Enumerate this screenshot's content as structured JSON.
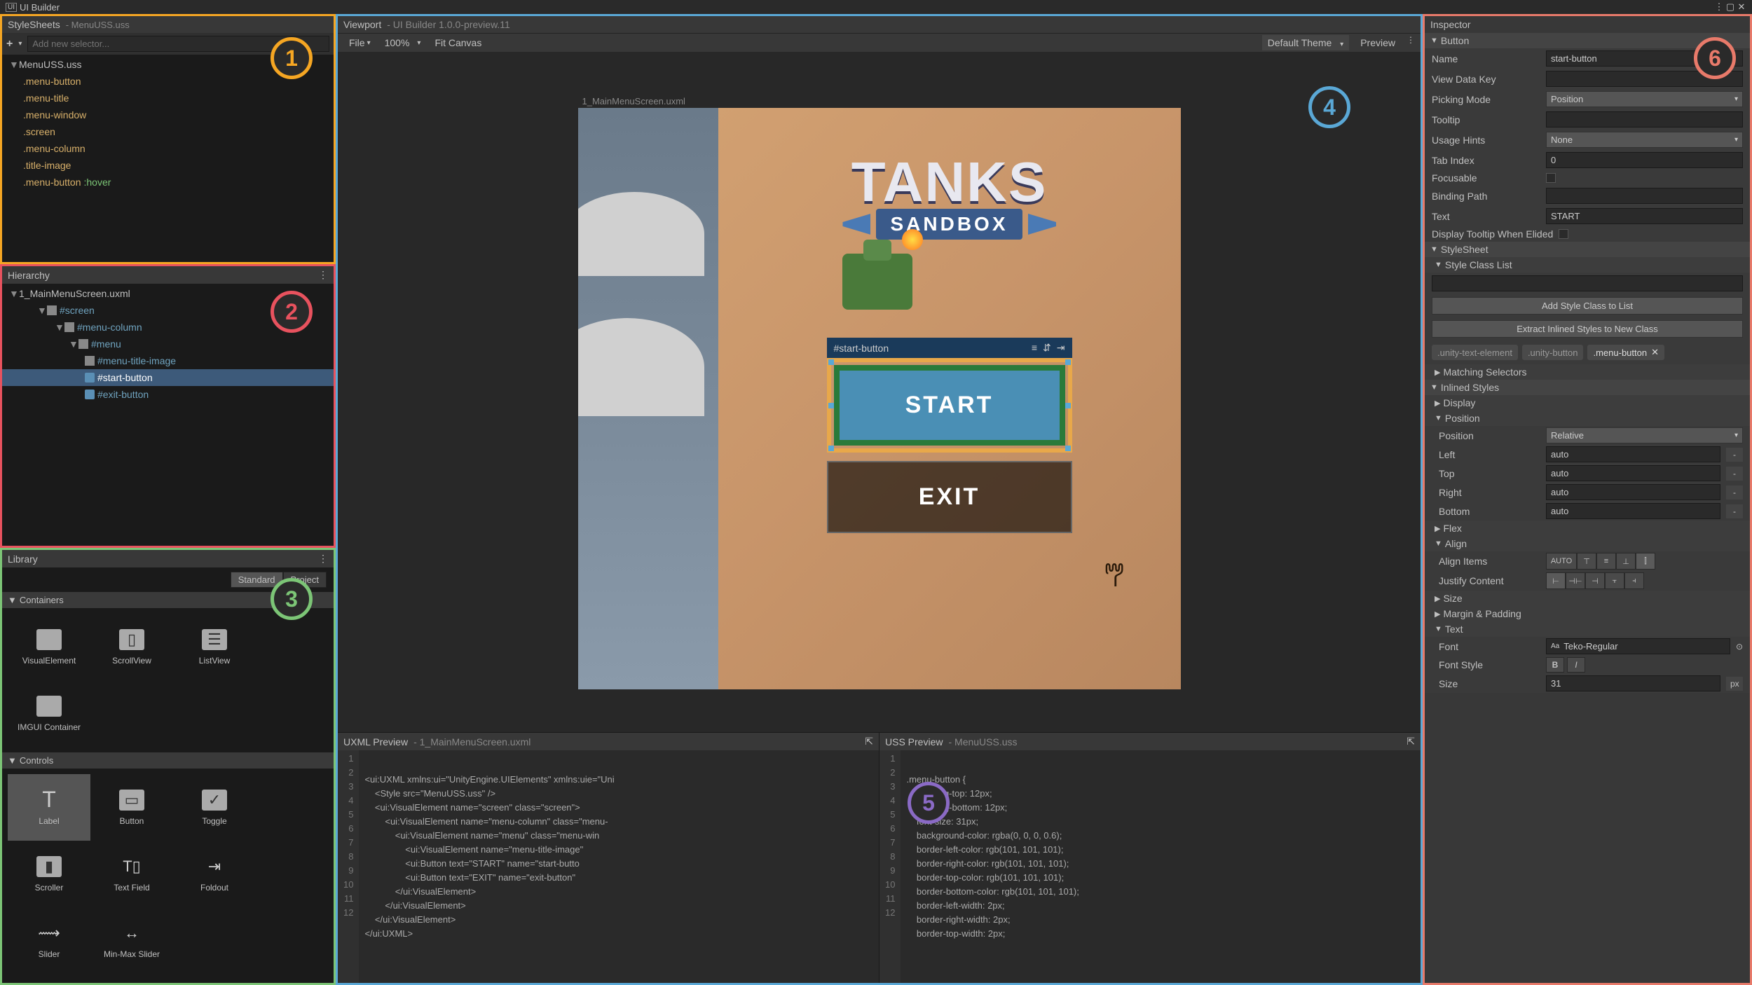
{
  "titlebar": {
    "icon_label": "UI",
    "title": "UI Builder"
  },
  "badges": {
    "b1": "1",
    "b2": "2",
    "b3": "3",
    "b4": "4",
    "b5": "5",
    "b6": "6"
  },
  "stylesheets": {
    "title": "StyleSheets",
    "subtitle": "MenuUSS.uss",
    "add_placeholder": "Add new selector...",
    "file": "MenuUSS.uss",
    "selectors": [
      ".menu-button",
      ".menu-title",
      ".menu-window",
      ".screen",
      ".menu-column",
      ".title-image"
    ],
    "hover_item": {
      "base": ".menu-button",
      "pseudo": ":hover"
    }
  },
  "hierarchy": {
    "title": "Hierarchy",
    "root": "1_MainMenuScreen.uxml",
    "items": [
      {
        "name": "#screen",
        "indent": 2,
        "type": "ve"
      },
      {
        "name": "#menu-column",
        "indent": 3,
        "type": "ve"
      },
      {
        "name": "#menu",
        "indent": 4,
        "type": "ve"
      },
      {
        "name": "#menu-title-image",
        "indent": 5,
        "type": "ve"
      },
      {
        "name": "#start-button",
        "indent": 5,
        "type": "btn",
        "selected": true
      },
      {
        "name": "#exit-button",
        "indent": 5,
        "type": "btn"
      }
    ]
  },
  "library": {
    "title": "Library",
    "tabs": {
      "standard": "Standard",
      "project": "Project"
    },
    "containers_hdr": "Containers",
    "containers": [
      {
        "label": "VisualElement"
      },
      {
        "label": "ScrollView"
      },
      {
        "label": "ListView"
      },
      {
        "label": "IMGUI Container"
      }
    ],
    "controls_hdr": "Controls",
    "controls": [
      {
        "label": "Label"
      },
      {
        "label": "Button"
      },
      {
        "label": "Toggle"
      },
      {
        "label": "Scroller"
      },
      {
        "label": "Text Field"
      },
      {
        "label": "Foldout"
      },
      {
        "label": "Slider"
      },
      {
        "label": "Min-Max Slider"
      }
    ]
  },
  "viewport": {
    "title": "Viewport",
    "subtitle": "UI Builder 1.0.0-preview.11",
    "file_menu": "File",
    "zoom": "100%",
    "fit": "Fit Canvas",
    "theme": "Default Theme",
    "preview": "Preview",
    "frame_label": "1_MainMenuScreen.uxml",
    "game": {
      "title": "TANKS",
      "subtitle": "SANDBOX",
      "start": "START",
      "exit": "EXIT",
      "selection_label": "#start-button"
    }
  },
  "uxml_preview": {
    "title": "UXML Preview",
    "subtitle": "1_MainMenuScreen.uxml",
    "lines": [
      "<ui:UXML xmlns:ui=\"UnityEngine.UIElements\" xmlns:uie=\"Uni",
      "    <Style src=\"MenuUSS.uss\" />",
      "    <ui:VisualElement name=\"screen\" class=\"screen\">",
      "        <ui:VisualElement name=\"menu-column\" class=\"menu-",
      "            <ui:VisualElement name=\"menu\" class=\"menu-win",
      "                <ui:VisualElement name=\"menu-title-image\"",
      "                <ui:Button text=\"START\" name=\"start-butto",
      "                <ui:Button text=\"EXIT\" name=\"exit-button\"",
      "            </ui:VisualElement>",
      "        </ui:VisualElement>",
      "    </ui:VisualElement>",
      "</ui:UXML>"
    ]
  },
  "uss_preview": {
    "title": "USS Preview",
    "subtitle": "MenuUSS.uss",
    "lines": [
      ".menu-button {",
      "    padding-top: 12px;",
      "    padding-bottom: 12px;",
      "    font-size: 31px;",
      "    background-color: rgba(0, 0, 0, 0.6);",
      "    border-left-color: rgb(101, 101, 101);",
      "    border-right-color: rgb(101, 101, 101);",
      "    border-top-color: rgb(101, 101, 101);",
      "    border-bottom-color: rgb(101, 101, 101);",
      "    border-left-width: 2px;",
      "    border-right-width: 2px;",
      "    border-top-width: 2px;"
    ]
  },
  "inspector": {
    "title": "Inspector",
    "button_hdr": "Button",
    "fields": {
      "name_lbl": "Name",
      "name_val": "start-button",
      "viewdatakey_lbl": "View Data Key",
      "viewdatakey_val": "",
      "pickingmode_lbl": "Picking Mode",
      "pickingmode_val": "Position",
      "tooltip_lbl": "Tooltip",
      "tooltip_val": "",
      "usagehints_lbl": "Usage Hints",
      "usagehints_val": "None",
      "tabindex_lbl": "Tab Index",
      "tabindex_val": "0",
      "focusable_lbl": "Focusable",
      "bindingpath_lbl": "Binding Path",
      "bindingpath_val": "",
      "text_lbl": "Text",
      "text_val": "START",
      "tooltip_elided_lbl": "Display Tooltip When Elided"
    },
    "stylesheet_hdr": "StyleSheet",
    "styleclass_hdr": "Style Class List",
    "add_class_btn": "Add Style Class to List",
    "extract_btn": "Extract Inlined Styles to New Class",
    "tags": [
      {
        "name": ".unity-text-element"
      },
      {
        "name": ".unity-button"
      },
      {
        "name": ".menu-button",
        "removable": true
      }
    ],
    "matching_hdr": "Matching Selectors",
    "inlined_hdr": "Inlined Styles",
    "display_hdr": "Display",
    "position_hdr": "Position",
    "position": {
      "position_lbl": "Position",
      "position_val": "Relative",
      "left_lbl": "Left",
      "left_val": "auto",
      "top_lbl": "Top",
      "top_val": "auto",
      "right_lbl": "Right",
      "right_val": "auto",
      "bottom_lbl": "Bottom",
      "bottom_val": "auto"
    },
    "flex_hdr": "Flex",
    "align_hdr": "Align",
    "align": {
      "items_lbl": "Align Items",
      "auto_btn": "AUTO",
      "justify_lbl": "Justify Content"
    },
    "size_hdr": "Size",
    "margin_hdr": "Margin & Padding",
    "text_hdr": "Text",
    "text": {
      "font_lbl": "Font",
      "font_val": "Teko-Regular",
      "font_prefix": "Aa",
      "fontstyle_lbl": "Font Style",
      "size_lbl": "Size",
      "size_val": "31",
      "size_unit": "px"
    }
  }
}
